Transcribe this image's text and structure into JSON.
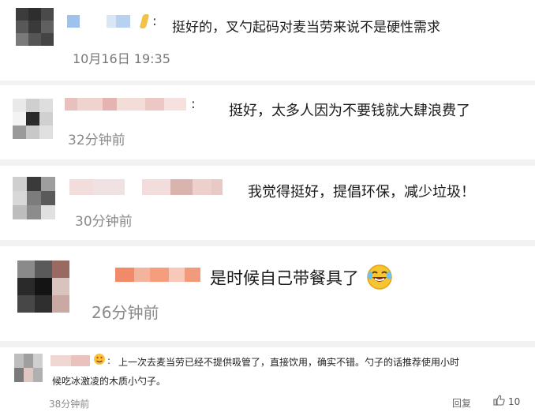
{
  "comments": [
    {
      "text": "挺好的，叉勺起码对麦当劳来说不是硬性需求",
      "time": "10月16日 19:35",
      "emoji_icon": "",
      "colors": {
        "avatar": [
          "#3c3c3c",
          "#2e2e2e",
          "#4a4a4a",
          "#585858",
          "#3a3a3a",
          "#606060",
          "#7a7a7a",
          "#555555",
          "#444444"
        ],
        "name": [
          "#9ec2ea",
          "#d8e6f6",
          "#b8d1ee",
          "#f0c24a"
        ]
      }
    },
    {
      "text": "挺好，太多人因为不要钱就大肆浪费了",
      "time": "32分钟前",
      "colors": {
        "avatar": [
          "#e9e9e9",
          "#cfcfcf",
          "#dedede",
          "#f3f3f3",
          "#2a2a2a",
          "#d0d0d0",
          "#9a9a9a",
          "#c8c8c8",
          "#e0e0e0"
        ],
        "name": [
          "#e8c1bd",
          "#f0d2ce",
          "#e6b4b0",
          "#f4dcd9",
          "#ecc7c4",
          "#f6e1df"
        ]
      }
    },
    {
      "text": "我觉得挺好，提倡环保，减少垃圾！",
      "time": "30分钟前",
      "colors": {
        "avatar": [
          "#cfcfcf",
          "#3a3a3a",
          "#9e9e9e",
          "#d8d8d8",
          "#7c7c7c",
          "#5a5a5a",
          "#bdbdbd",
          "#8c8c8c",
          "#e0e0e0"
        ],
        "name": [
          "#f3dcdc",
          "#f0e2e2",
          "#d9b3ad",
          "#edd0cc",
          "#e8c9c3"
        ]
      }
    },
    {
      "text": "是时候自己带餐具了",
      "time": "26分钟前",
      "emoji_icon": "laughing-crying-face-icon",
      "colors": {
        "avatar": [
          "#8a8a8a",
          "#5a5a5a",
          "#9a6a62",
          "#2a2a2a",
          "#141414",
          "#d8c4bd",
          "#474747",
          "#2f2f2f",
          "#c9a9a1"
        ],
        "name": [
          "#f08a68",
          "#f4b39c",
          "#f59d7d",
          "#f7c9b8",
          "#f29a7c"
        ]
      }
    },
    {
      "text_line1": "上一次去麦当劳已经不提供吸管了，直接饮用，确实不错。勺子的话推荐使用小时",
      "text_line2": "候吃冰激凌的木质小勺子。",
      "time": "38分钟前",
      "reply_label": "回复",
      "like_count": "10",
      "like_icon": "thumbs-up-icon",
      "name_icon": "heart-eyes-emoji-icon",
      "colors": {
        "avatar": [
          "#bdbdbd",
          "#9f9f9f",
          "#cfcfcf",
          "#7a7a7a",
          "#e0c6c0",
          "#b0b0b0"
        ],
        "name": [
          "#f1d7d4",
          "#e9c2be"
        ]
      }
    }
  ]
}
